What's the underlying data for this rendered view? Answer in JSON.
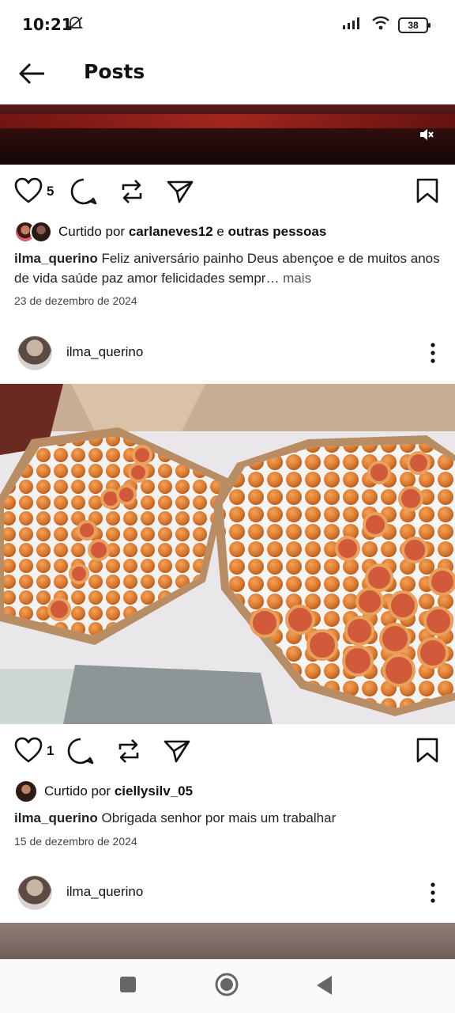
{
  "status": {
    "time": "10:21",
    "battery": "38"
  },
  "header": {
    "title": "Posts"
  },
  "post1": {
    "likes": "5",
    "liked_prefix": "Curtido por ",
    "liked_user": "carlaneves12",
    "liked_mid": " e ",
    "liked_others": "outras pessoas",
    "caption_user": "ilma_querino",
    "caption_text": " Feliz aniversário painho Deus abençoe e de muitos anos de vida saúde paz amor felicidades sempr…",
    "caption_more": " mais",
    "date": "23 de dezembro de 2024"
  },
  "post2": {
    "author": "ilma_querino",
    "likes": "1",
    "liked_prefix": "Curtido por ",
    "liked_user": "ciellysilv_05",
    "caption_user": "ilma_querino",
    "caption_text": " Obrigada senhor por mais um trabalhar",
    "date": "15 de dezembro de 2024"
  },
  "post3": {
    "author": "ilma_querino"
  },
  "icons": {
    "like": "heart-icon",
    "comment": "comment-icon",
    "repost": "repost-icon",
    "share": "send-icon",
    "save": "bookmark-icon",
    "more": "more-vertical-icon"
  }
}
